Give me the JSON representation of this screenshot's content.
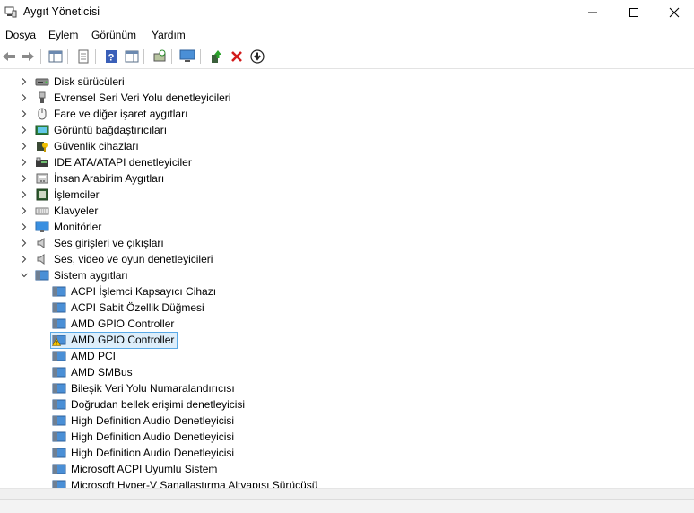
{
  "window": {
    "title": "Aygıt Yöneticisi"
  },
  "menu": [
    "Dosya",
    "Eylem",
    "Görünüm",
    "Yardım"
  ],
  "categories": [
    {
      "label": "Disk sürücüleri",
      "icon": "disk-drive-icon"
    },
    {
      "label": "Evrensel Seri Veri Yolu denetleyicileri",
      "icon": "usb-icon"
    },
    {
      "label": "Fare ve diğer işaret aygıtları",
      "icon": "mouse-icon"
    },
    {
      "label": "Görüntü bağdaştırıcıları",
      "icon": "display-adapter-icon"
    },
    {
      "label": "Güvenlik cihazları",
      "icon": "security-device-icon"
    },
    {
      "label": "IDE ATA/ATAPI denetleyiciler",
      "icon": "ide-controller-icon"
    },
    {
      "label": "İnsan Arabirim Aygıtları",
      "icon": "hid-icon"
    },
    {
      "label": "İşlemciler",
      "icon": "processor-icon"
    },
    {
      "label": "Klavyeler",
      "icon": "keyboard-icon"
    },
    {
      "label": "Monitörler",
      "icon": "monitor-icon"
    },
    {
      "label": "Ses girişleri ve çıkışları",
      "icon": "speaker-icon"
    },
    {
      "label": "Ses, video ve oyun denetleyicileri",
      "icon": "speaker-icon"
    },
    {
      "label": "Sistem aygıtları",
      "icon": "system-devices-icon",
      "expanded": true
    }
  ],
  "system_devices": [
    {
      "label": "ACPI İşlemci Kapsayıcı Cihazı"
    },
    {
      "label": "ACPI Sabit Özellik Düğmesi"
    },
    {
      "label": "AMD GPIO Controller"
    },
    {
      "label": "AMD GPIO Controller",
      "selected": true,
      "warning": true
    },
    {
      "label": "AMD PCI"
    },
    {
      "label": "AMD SMBus"
    },
    {
      "label": "Bileşik Veri Yolu Numaralandırıcısı"
    },
    {
      "label": "Doğrudan bellek erişimi denetleyicisi"
    },
    {
      "label": "High Definition Audio Denetleyicisi"
    },
    {
      "label": "High Definition Audio Denetleyicisi"
    },
    {
      "label": "High Definition Audio Denetleyicisi"
    },
    {
      "label": "Microsoft ACPI Uyumlu Sistem"
    },
    {
      "label": "Microsoft Hyper-V Sanallaştırma Altyapısı Sürücüsü"
    }
  ]
}
